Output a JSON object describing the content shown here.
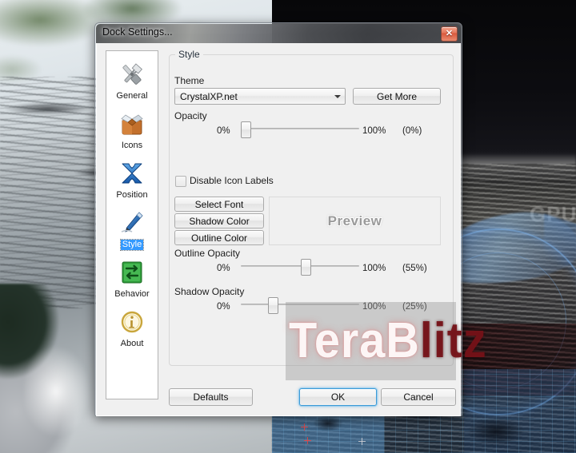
{
  "desktop": {
    "watermark": {
      "light": "TeraB",
      "dark": "litz"
    },
    "background_label": "moon-surface-wallpaper",
    "bg_overlay_text": "GPU"
  },
  "dialog": {
    "title": "Dock Settings...",
    "close_glyph": "✕",
    "sidebar": {
      "items": [
        {
          "label": "General",
          "icon": "tools-icon",
          "selected": false
        },
        {
          "label": "Icons",
          "icon": "box-icon",
          "selected": false
        },
        {
          "label": "Position",
          "icon": "move-arrows-icon",
          "selected": false
        },
        {
          "label": "Style",
          "icon": "pen-icon",
          "selected": true
        },
        {
          "label": "Behavior",
          "icon": "swap-arrows-icon",
          "selected": false
        },
        {
          "label": "About",
          "icon": "info-icon",
          "selected": false
        }
      ]
    },
    "group": {
      "title": "Style",
      "theme_label": "Theme",
      "theme_value": "CrystalXP.net",
      "get_more_label": "Get More",
      "opacity_label": "Opacity",
      "opacity": {
        "min_label": "0%",
        "max_label": "100%",
        "value_label": "(0%)",
        "percent": 0
      },
      "disable_icon_labels": {
        "label": "Disable Icon Labels",
        "checked": false
      },
      "select_font_label": "Select Font",
      "shadow_color_label": "Shadow Color",
      "outline_color_label": "Outline Color",
      "preview_text": "Preview",
      "outline_opacity_label": "Outline Opacity",
      "outline_opacity": {
        "min_label": "0%",
        "max_label": "100%",
        "value_label": "(55%)",
        "percent": 55
      },
      "shadow_opacity_label": "Shadow Opacity",
      "shadow_opacity": {
        "min_label": "0%",
        "max_label": "100%",
        "value_label": "(25%)",
        "percent": 25
      }
    },
    "footer": {
      "defaults_label": "Defaults",
      "ok_label": "OK",
      "cancel_label": "Cancel"
    },
    "colors": {
      "selection_blue": "#3399ff",
      "focus_blue": "#3c9ad6",
      "dialog_bg": "#f0f0f0",
      "close_red": "#d9583c"
    }
  }
}
